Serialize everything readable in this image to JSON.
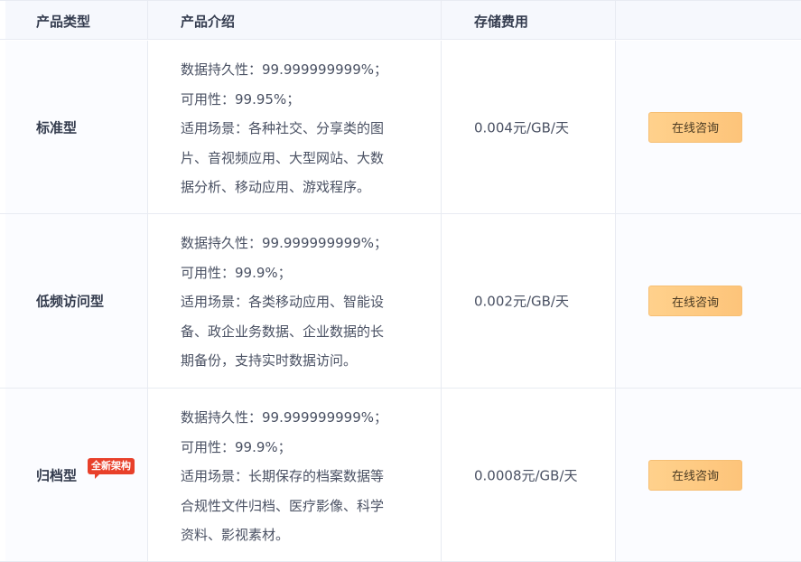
{
  "header": {
    "col1": "产品类型",
    "col2": "产品介绍",
    "col3": "存储费用",
    "col4": ""
  },
  "rows": [
    {
      "type": "标准型",
      "badge": "",
      "desc": [
        "数据持久性：99.999999999%；",
        "可用性：99.95%；",
        "适用场景：各种社交、分享类的图",
        "片、音视频应用、大型网站、大数",
        "据分析、移动应用、游戏程序。"
      ],
      "price": "0.004元/GB/天",
      "button": "在线咨询"
    },
    {
      "type": "低频访问型",
      "badge": "",
      "desc": [
        "数据持久性：99.999999999%；",
        "可用性：99.9%；",
        "适用场景：各类移动应用、智能设",
        "备、政企业务数据、企业数据的长",
        "期备份，支持实时数据访问。"
      ],
      "price": "0.002元/GB/天",
      "button": "在线咨询"
    },
    {
      "type": "归档型",
      "badge": "全新架构",
      "desc": [
        "数据持久性：99.999999999%；",
        "可用性：99.9%；",
        "适用场景：长期保存的档案数据等",
        "合规性文件归档、医疗影像、科学",
        "资料、影视素材。"
      ],
      "price": "0.0008元/GB/天",
      "button": "在线咨询"
    }
  ],
  "colors": {
    "header_bg": "#f6f8fd",
    "button_bg": "#fdc47a",
    "badge_bg": "#e8402a"
  }
}
